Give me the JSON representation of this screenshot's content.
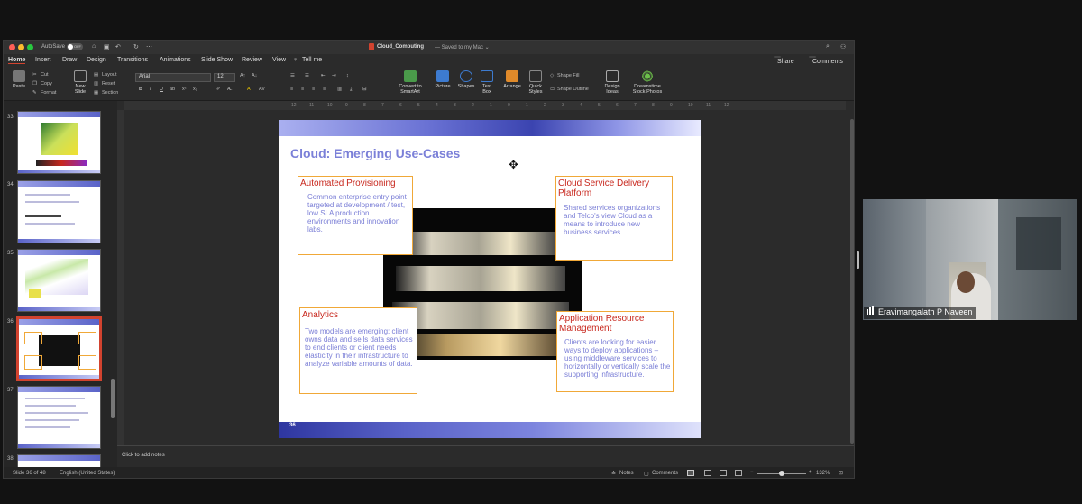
{
  "window": {
    "title": "Cloud_Computing",
    "save_status": "— Saved to my Mac ⌄",
    "autosave_label": "AutoSave",
    "autosave_state": "OFF"
  },
  "menu": {
    "tabs": [
      "Home",
      "Insert",
      "Draw",
      "Design",
      "Transitions",
      "Animations",
      "Slide Show",
      "Review",
      "View"
    ],
    "tell_me": "Tell me",
    "share": "Share",
    "comments": "Comments"
  },
  "ribbon": {
    "paste": "Paste",
    "cut": "Cut",
    "copy": "Copy",
    "format": "Format",
    "new_slide": "New Slide",
    "layout": "Layout",
    "reset": "Reset",
    "section": "Section",
    "font_name": "Arial",
    "font_size": "12",
    "convert_smartart": "Convert to SmartArt",
    "picture": "Picture",
    "shapes": "Shapes",
    "text_box": "Text Box",
    "arrange": "Arrange",
    "quick_styles": "Quick Styles",
    "shape_fill": "Shape Fill",
    "shape_outline": "Shape Outline",
    "design_ideas": "Design Ideas",
    "dreamstime": "Dreamstime Stock Photos"
  },
  "ruler": {
    "top_ticks": [
      "12",
      "11",
      "10",
      "9",
      "8",
      "7",
      "6",
      "5",
      "4",
      "3",
      "2",
      "1",
      "0",
      "1",
      "2",
      "3",
      "4",
      "5",
      "6",
      "7",
      "8",
      "9",
      "10",
      "11",
      "12"
    ]
  },
  "thumbnails": [
    {
      "num": "33",
      "selected": false
    },
    {
      "num": "34",
      "selected": false
    },
    {
      "num": "35",
      "selected": false
    },
    {
      "num": "36",
      "selected": true
    },
    {
      "num": "37",
      "selected": false
    },
    {
      "num": "38",
      "selected": false
    }
  ],
  "slide": {
    "title": "Cloud: Emerging Use-Cases",
    "page_number": "36",
    "boxes": {
      "auto": {
        "heading": "Automated Provisioning",
        "body": "Common enterprise entry point targeted at development / test, low SLA production environments and innovation labs."
      },
      "csd": {
        "heading": "Cloud Service Delivery Platform",
        "body": "Shared services organizations and Telco's view Cloud as a means to introduce new business services."
      },
      "analytics": {
        "heading": "Analytics",
        "body": "Two models are emerging: client owns data and sells data services to end clients or client needs elasticity in their infrastructure to analyze variable amounts of data."
      },
      "arm": {
        "heading": "Application Resource Management",
        "body": "Clients are looking for easier ways to deploy applications – using middleware services to horizontally or vertically scale the supporting infrastructure."
      }
    }
  },
  "notes": {
    "placeholder": "Click to add notes"
  },
  "status": {
    "slide_info": "Slide 36 of 48",
    "language": "English (United States)",
    "notes_btn": "Notes",
    "comments_btn": "Comments",
    "zoom": "132%"
  },
  "video": {
    "participant_name": "Eravimangalath P Naveen"
  },
  "colors": {
    "accent_red": "#c8281e",
    "box_border": "#f0a838",
    "slide_text": "#7a7ed6",
    "title": "#7b80d8"
  }
}
